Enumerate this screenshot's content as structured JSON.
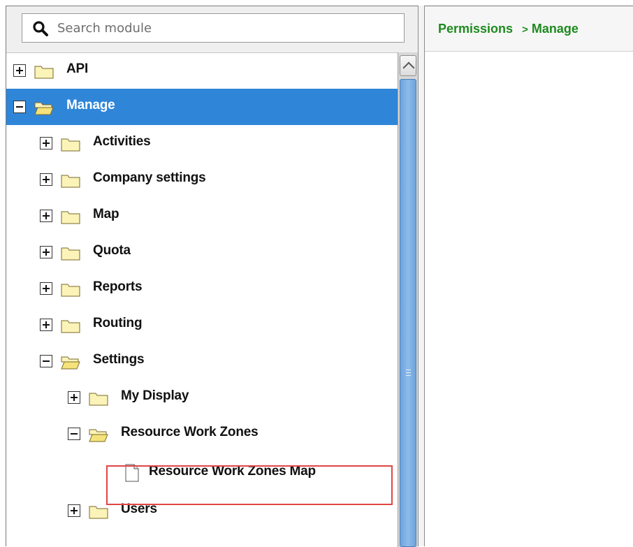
{
  "colors": {
    "selection": "#2f86d8",
    "breadcrumb": "#1e8a1e",
    "highlight_border": "#e04646",
    "scroll_thumb": "#7fb0e4"
  },
  "search": {
    "placeholder": "Search module",
    "value": "",
    "icon": "search-icon"
  },
  "breadcrumb": {
    "root": "Permissions",
    "separator": ">",
    "current": "Manage"
  },
  "tree": [
    {
      "label": "API",
      "type": "folder",
      "state": "collapsed",
      "level": 0,
      "selected": false
    },
    {
      "label": "Manage",
      "type": "folder",
      "state": "expanded",
      "level": 0,
      "selected": true
    },
    {
      "label": "Activities",
      "type": "folder",
      "state": "collapsed",
      "level": 1,
      "selected": false
    },
    {
      "label": "Company settings",
      "type": "folder",
      "state": "collapsed",
      "level": 1,
      "selected": false
    },
    {
      "label": "Map",
      "type": "folder",
      "state": "collapsed",
      "level": 1,
      "selected": false
    },
    {
      "label": "Quota",
      "type": "folder",
      "state": "collapsed",
      "level": 1,
      "selected": false
    },
    {
      "label": "Reports",
      "type": "folder",
      "state": "collapsed",
      "level": 1,
      "selected": false
    },
    {
      "label": "Routing",
      "type": "folder",
      "state": "collapsed",
      "level": 1,
      "selected": false
    },
    {
      "label": "Settings",
      "type": "folder",
      "state": "expanded",
      "level": 1,
      "selected": false
    },
    {
      "label": "My Display",
      "type": "folder",
      "state": "collapsed",
      "level": 2,
      "selected": false
    },
    {
      "label": "Resource Work Zones",
      "type": "folder",
      "state": "expanded",
      "level": 2,
      "selected": false
    },
    {
      "label": "Resource Work Zones Map",
      "type": "document",
      "state": "leaf",
      "level": 3,
      "selected": false,
      "highlighted": true
    },
    {
      "label": "Users",
      "type": "folder",
      "state": "collapsed",
      "level": 2,
      "selected": false
    }
  ]
}
